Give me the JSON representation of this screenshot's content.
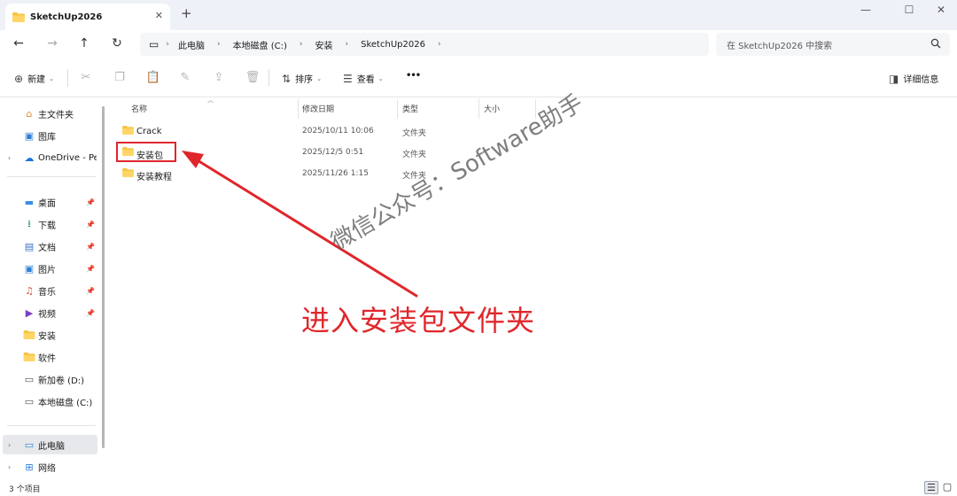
{
  "window": {
    "tab_title": "SketchUp2026",
    "tab_close": "✕",
    "new_tab": "+",
    "minimize": "—",
    "maximize": "☐",
    "close": "✕"
  },
  "nav": {
    "back": "←",
    "forward": "→",
    "up": "↑",
    "refresh": "↻",
    "monitor_icon": "▭",
    "breadcrumbs": [
      "此电脑",
      "本地磁盘 (C:)",
      "安装",
      "SketchUp2026"
    ],
    "separator": "›",
    "search_placeholder": "在 SketchUp2026 中搜索"
  },
  "toolbar": {
    "new_label": "新建",
    "sort_label": "排序",
    "view_label": "查看",
    "more": "•••",
    "details_label": "详细信息"
  },
  "sidebar": {
    "items": [
      {
        "label": "主文件夹",
        "icon": "home-icon"
      },
      {
        "label": "图库",
        "icon": "gallery-icon"
      },
      {
        "label": "OneDrive - Personal",
        "icon": "cloud-icon"
      },
      {
        "label": "桌面",
        "icon": "desktop-icon"
      },
      {
        "label": "下载",
        "icon": "download-icon"
      },
      {
        "label": "文档",
        "icon": "document-icon"
      },
      {
        "label": "图片",
        "icon": "picture-icon"
      },
      {
        "label": "音乐",
        "icon": "music-icon"
      },
      {
        "label": "视频",
        "icon": "video-icon"
      },
      {
        "label": "安装",
        "icon": "folder-icon"
      },
      {
        "label": "软件",
        "icon": "folder-icon"
      },
      {
        "label": "新加卷 (D:)",
        "icon": "drive-icon"
      },
      {
        "label": "本地磁盘 (C:)",
        "icon": "drive-icon"
      },
      {
        "label": "此电脑",
        "icon": "computer-icon"
      },
      {
        "label": "网络",
        "icon": "network-icon"
      }
    ]
  },
  "files": {
    "columns": [
      "名称",
      "修改日期",
      "类型",
      "大小"
    ],
    "rows": [
      {
        "name": "Crack",
        "date": "2025/10/11 10:06",
        "type": "文件夹"
      },
      {
        "name": "安装包",
        "date": "2025/12/5 0:51",
        "type": "文件夹"
      },
      {
        "name": "安装教程",
        "date": "2025/11/26 1:15",
        "type": "文件夹"
      }
    ]
  },
  "annotation": {
    "text": "进入安装包文件夹",
    "watermark": "微信公众号：Software助手"
  },
  "status": {
    "item_count": "3 个项目"
  },
  "colors": {
    "accent_red": "#e0262b",
    "folder_yellow": "#f5c542",
    "titlebar_bg": "#eef1f7"
  }
}
